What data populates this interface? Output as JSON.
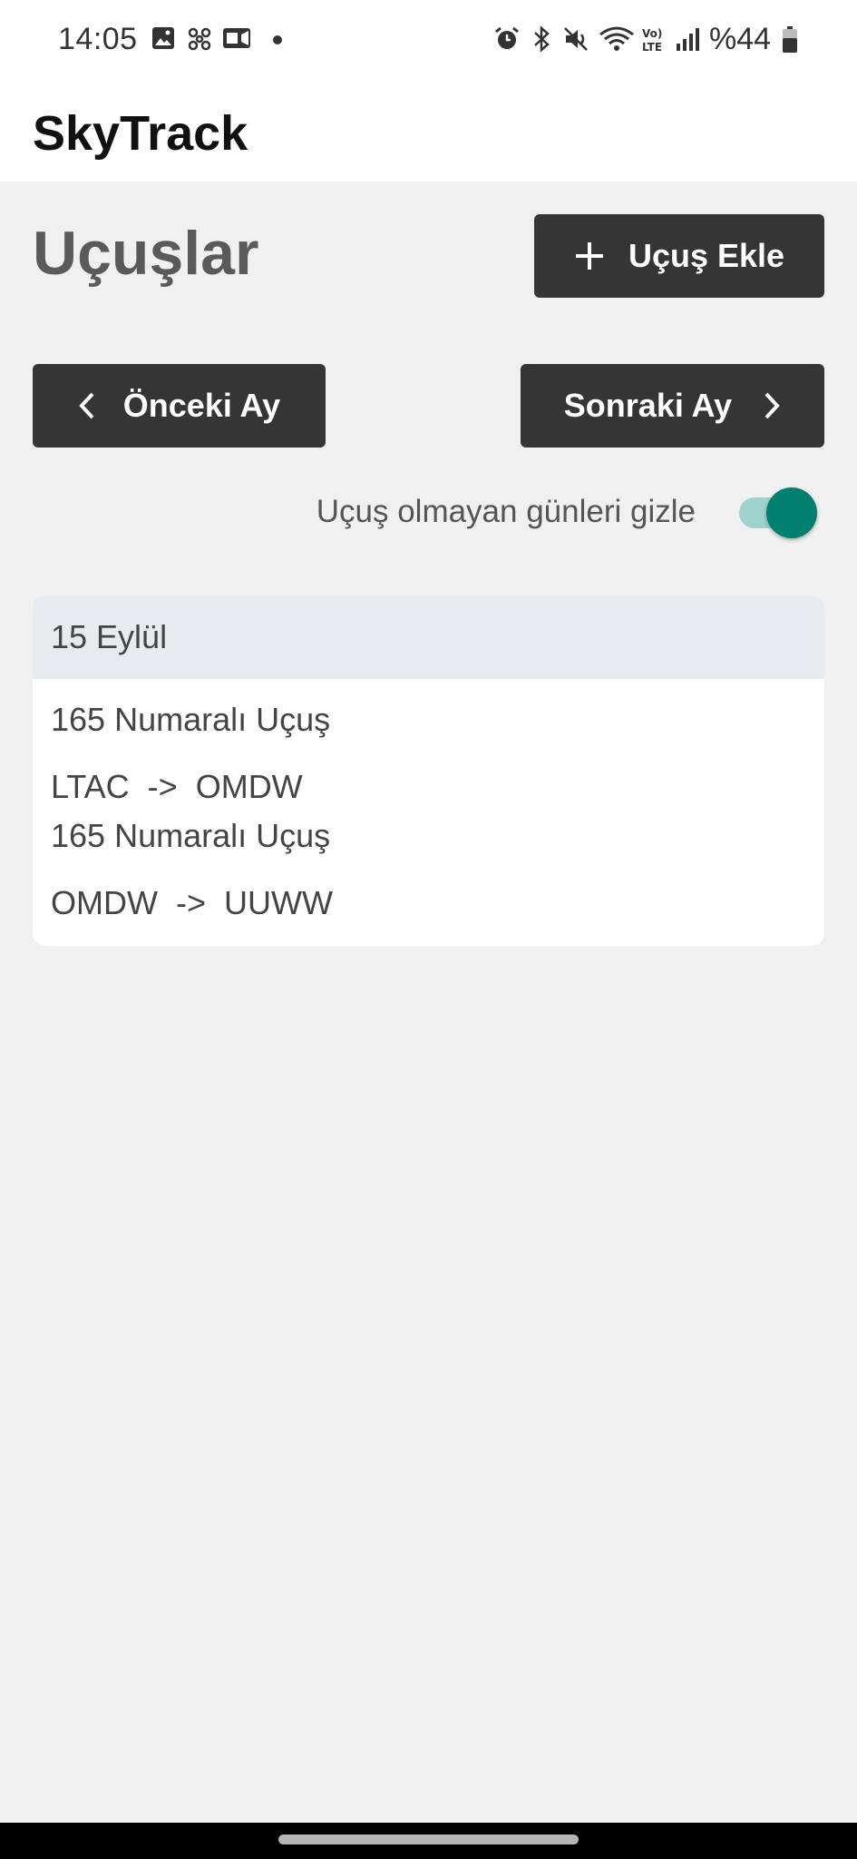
{
  "status_bar": {
    "time": "14:05",
    "battery": "%44",
    "icons": [
      "image-icon",
      "fan-icon",
      "camera-icon",
      "dot-icon",
      "alarm-icon",
      "bluetooth-icon",
      "mute-icon",
      "wifi-icon",
      "volte-icon",
      "signal-icon",
      "battery-icon"
    ]
  },
  "app_bar": {
    "title": "SkyTrack"
  },
  "main": {
    "title": "Uçuşlar",
    "add_button_label": "Uçuş Ekle",
    "prev_button_label": "Önceki Ay",
    "next_button_label": "Sonraki Ay",
    "toggle_label": "Uçuş olmayan günleri gizle",
    "toggle_on": true
  },
  "days": [
    {
      "date": "15 Eylül",
      "flights": [
        {
          "title": "165 Numaralı Uçuş",
          "route": "LTAC  ->  OMDW"
        },
        {
          "title": "165 Numaralı Uçuş",
          "route": "OMDW  ->  UUWW"
        }
      ]
    }
  ],
  "colors": {
    "accent": "#00806f",
    "button_bg": "#353535",
    "background": "#f0f0f0"
  }
}
